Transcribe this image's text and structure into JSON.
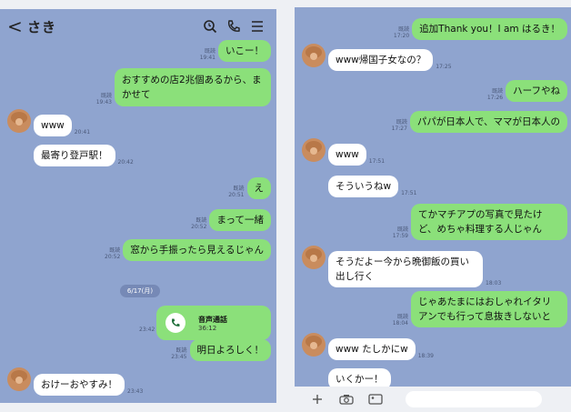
{
  "left": {
    "header": {
      "back": "<",
      "title": "さき"
    },
    "messages": [
      {
        "text": "いこー！",
        "read": "既読",
        "time": "19:41"
      },
      {
        "text": "おすすめの店2兆個あるから、まかせて",
        "read": "既読",
        "time": "19:43"
      },
      {
        "text": "www",
        "time": "20:41"
      },
      {
        "text": "最寄り登戸駅！",
        "time": "20:42"
      },
      {
        "text": "え",
        "read": "既読",
        "time": "20:51"
      },
      {
        "text": "まって一緒",
        "read": "既読",
        "time": "20:52"
      },
      {
        "text": "窓から手振ったら見えるじゃん",
        "read": "既読",
        "time": "20:52"
      },
      {
        "text": "明日よろしく！",
        "read": "既読",
        "time": "23:45"
      },
      {
        "text": "おけーおやすみ！",
        "time": "23:43"
      }
    ],
    "date_chip": "6/17(月)",
    "call": {
      "title": "音声通話",
      "duration": "36:12",
      "time": "23:42"
    }
  },
  "right": {
    "messages": [
      {
        "text": "追加Thank you！I am はるき！",
        "read": "既読",
        "time": "17:20"
      },
      {
        "text": "www帰国子女なの？",
        "time": "17:25"
      },
      {
        "text": "ハーフやね",
        "read": "既読",
        "time": "17:26"
      },
      {
        "text": "パパが日本人で、ママが日本人の",
        "read": "既読",
        "time": "17:27"
      },
      {
        "text": "www",
        "time": "17:51"
      },
      {
        "text": "そういうねw",
        "time": "17:51"
      },
      {
        "text": "てかマチアプの写真で見たけど、めちゃ料理する人じゃん",
        "read": "既読",
        "time": "17:59"
      },
      {
        "text": "そうだよー今から晩御飯の買い出し行く",
        "time": "18:03"
      },
      {
        "text": "じゃあたまにはおしゃれイタリアンでも行って息抜きしないと",
        "read": "既読",
        "time": "18:04"
      },
      {
        "text": "www たしかにw",
        "time": "18:39"
      },
      {
        "text": "いくかー！"
      }
    ]
  }
}
